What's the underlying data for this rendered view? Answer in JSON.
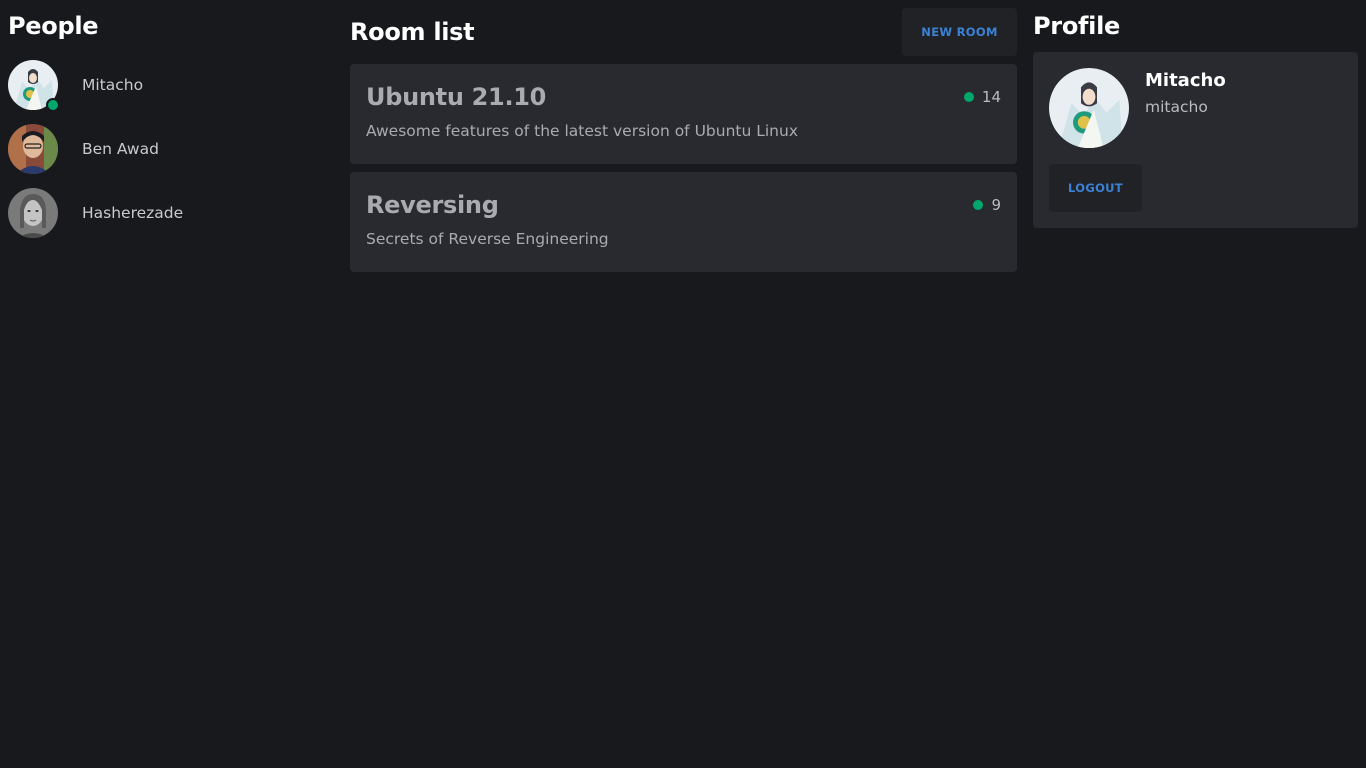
{
  "people": {
    "title": "People",
    "items": [
      {
        "name": "Mitacho",
        "online": true,
        "avatar_icon": "anime-character-avatar-icon"
      },
      {
        "name": "Ben Awad",
        "online": false,
        "avatar_icon": "user-photo-avatar-icon"
      },
      {
        "name": "Hasherezade",
        "online": false,
        "avatar_icon": "user-portrait-avatar-icon"
      }
    ]
  },
  "rooms": {
    "title": "Room list",
    "new_room_label": "NEW ROOM",
    "items": [
      {
        "title": "Ubuntu 21.10",
        "count": "14",
        "description": "Awesome features of the latest version of Ubuntu Linux"
      },
      {
        "title": "Reversing",
        "count": "9",
        "description": "Secrets of Reverse Engineering"
      }
    ]
  },
  "profile": {
    "title": "Profile",
    "display_name": "Mitacho",
    "username": "mitacho",
    "logout_label": "LOGOUT"
  },
  "colors": {
    "background": "#18191d",
    "card": "#292a30",
    "button_bg": "#212226",
    "accent": "#3b82d6",
    "online": "#00a86b"
  }
}
